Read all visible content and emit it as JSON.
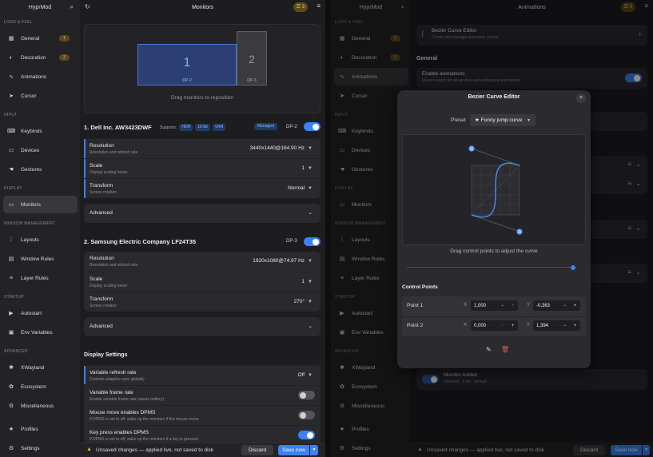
{
  "colors": {
    "accent": "#3b82f6",
    "warn": "#f0c85a",
    "bg": "#1d1d20",
    "card": "#2a2a2e"
  },
  "app_title": "HyprMod",
  "sidebar": {
    "sections": [
      "LOOK & FEEL",
      "INPUT",
      "DISPLAY",
      "WINDOW MANAGEMENT",
      "STARTUP",
      "ADVANCED"
    ],
    "items": [
      {
        "label": "General",
        "icon": "grid-icon",
        "badge": "1"
      },
      {
        "label": "Decoration",
        "icon": "palette-icon",
        "badge": "2"
      },
      {
        "label": "Animations",
        "icon": "animation-icon"
      },
      {
        "label": "Cursor",
        "icon": "cursor-icon"
      },
      {
        "label": "Keybinds",
        "icon": "keyboard-icon"
      },
      {
        "label": "Devices",
        "icon": "devices-icon"
      },
      {
        "label": "Gestures",
        "icon": "gesture-icon"
      },
      {
        "label": "Monitors",
        "icon": "monitor-icon"
      },
      {
        "label": "Layouts",
        "icon": "layout-icon"
      },
      {
        "label": "Window Rules",
        "icon": "window-rules-icon"
      },
      {
        "label": "Layer Rules",
        "icon": "layers-icon"
      },
      {
        "label": "Autostart",
        "icon": "play-icon"
      },
      {
        "label": "Env Variables",
        "icon": "env-icon"
      },
      {
        "label": "XWayland",
        "icon": "xwayland-icon"
      },
      {
        "label": "Ecosystem",
        "icon": "ecosystem-icon"
      },
      {
        "label": "Miscellaneous",
        "icon": "misc-icon"
      },
      {
        "label": "Profiles",
        "icon": "star-icon"
      },
      {
        "label": "Settings",
        "icon": "gear-icon"
      }
    ]
  },
  "left": {
    "title": "Monitors",
    "pending_count": "3",
    "preview": {
      "mon1_label": "1",
      "mon1_name": "DP-2",
      "mon2_label": "2",
      "mon2_name": "DP-3",
      "hint": "Drag monitors to reposition"
    },
    "monitor1": {
      "title": "1. Dell Inc. AW3423DWF",
      "supports": "Supports:",
      "features": [
        "HDR",
        "10-bit",
        "VRR"
      ],
      "managed": "Managed",
      "port": "DP-2",
      "enabled": true,
      "resolution": {
        "label": "Resolution",
        "sub": "Resolution and refresh rate",
        "value": "3440x1440@164.90 Hz"
      },
      "scale": {
        "label": "Scale",
        "sub": "Display scaling factor",
        "value": "1"
      },
      "transform": {
        "label": "Transform",
        "sub": "Screen rotation",
        "value": "Normal"
      },
      "advanced": "Advanced"
    },
    "monitor2": {
      "title": "2. Samsung Electric Company LF24T35",
      "port": "DP-3",
      "enabled": true,
      "resolution": {
        "label": "Resolution",
        "sub": "Resolution and refresh rate",
        "value": "1920x1080@74.97 Hz"
      },
      "scale": {
        "label": "Scale",
        "sub": "Display scaling factor",
        "value": "1"
      },
      "transform": {
        "label": "Transform",
        "sub": "Screen rotation",
        "value": "270°"
      },
      "advanced": "Advanced"
    },
    "display_settings": {
      "title": "Display Settings",
      "vrr": {
        "label": "Variable refresh rate",
        "sub": "Controls adaptive sync globally",
        "value": "Off"
      },
      "vfr": {
        "label": "Variable frame rate",
        "sub": "Enable variable frame rate (saves battery)",
        "on": false
      },
      "dpms_mouse": {
        "label": "Mouse move enables DPMS",
        "sub": "If DPMS is set to off, wake up the monitors if the mouse move",
        "on": false
      },
      "dpms_key": {
        "label": "Key press enables DPMS",
        "sub": "If DPMS is set to off, wake up the monitors if a key is pressed",
        "on": true
      }
    }
  },
  "bottom": {
    "message": "Unsaved changes — applied live, not saved to disk",
    "discard": "Discard",
    "save": "Save now"
  },
  "right": {
    "title": "Animations",
    "pending_count": "3",
    "bezier_row": {
      "label": "Bezier Curve Editor",
      "sub": "Create and manage animation curves"
    },
    "general": "General",
    "enable_anim": {
      "label": "Enable animations",
      "sub": "Master switch for all window and workspace animations"
    },
    "monitor_added": {
      "label": "Monitor Added",
      "sub": "inherited · 8 fds · default"
    },
    "dialog": {
      "title": "Bezier Curve Editor",
      "preset_label": "Preset",
      "preset_value": "★ Funny jump curve",
      "hint": "Drag control points to adjust the curve",
      "cp_title": "Control Points",
      "points": [
        {
          "label": "Point 1",
          "x": "1,000",
          "y": "-0,363"
        },
        {
          "label": "Point 2",
          "x": "0,000",
          "y": "1,394"
        }
      ],
      "x_label": "X",
      "y_label": "Y"
    }
  }
}
